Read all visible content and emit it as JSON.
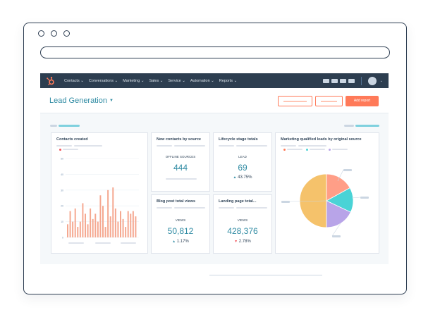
{
  "nav": {
    "items": [
      "Contacts ⌄",
      "Conversations ⌄",
      "Marketing ⌄",
      "Sales ⌄",
      "Service ⌄",
      "Automation ⌄",
      "Reports ⌄"
    ]
  },
  "header": {
    "title": "Lead Generation",
    "add_report_label": "Add report"
  },
  "cards": {
    "contacts_created": {
      "title": "Contacts created"
    },
    "new_contacts": {
      "title": "New contacts by source",
      "label": "OFFLINE SOURCES",
      "value": "444"
    },
    "lifecycle": {
      "title": "Lifecycle stage totals",
      "label": "LEAD",
      "value": "69",
      "change": "43.75%"
    },
    "mql": {
      "title": "Marketing qualified leads by original source"
    },
    "blog_views": {
      "title": "Blog post total views",
      "label": "VIEWS",
      "value": "50,812",
      "change": "1.17%"
    },
    "landing_views": {
      "title": "Landing page total...",
      "label": "VIEWS",
      "value": "428,376",
      "change": "2.78%"
    }
  },
  "colors": {
    "accent": "#ff7a59",
    "teal": "#2f8ba3",
    "nav": "#2d3e50"
  },
  "chart_data": [
    {
      "type": "bar",
      "title": "Contacts created",
      "y_ticks": [
        "0",
        "10",
        "20",
        "30",
        "40",
        "50"
      ],
      "ylim": [
        0,
        60
      ],
      "values": [
        10,
        20,
        12,
        22,
        8,
        12,
        26,
        18,
        10,
        22,
        14,
        18,
        12,
        32,
        24,
        8,
        36,
        16,
        38,
        22,
        12,
        20,
        14,
        8,
        20,
        18,
        20,
        16
      ]
    },
    {
      "type": "pie",
      "title": "Marketing qualified leads by original source",
      "slices": [
        {
          "value": 50,
          "color": "#f5c26b"
        },
        {
          "value": 17,
          "color": "#ff9e87"
        },
        {
          "value": 15,
          "color": "#4ad3d6"
        },
        {
          "value": 18,
          "color": "#b8a4e8"
        }
      ]
    }
  ]
}
